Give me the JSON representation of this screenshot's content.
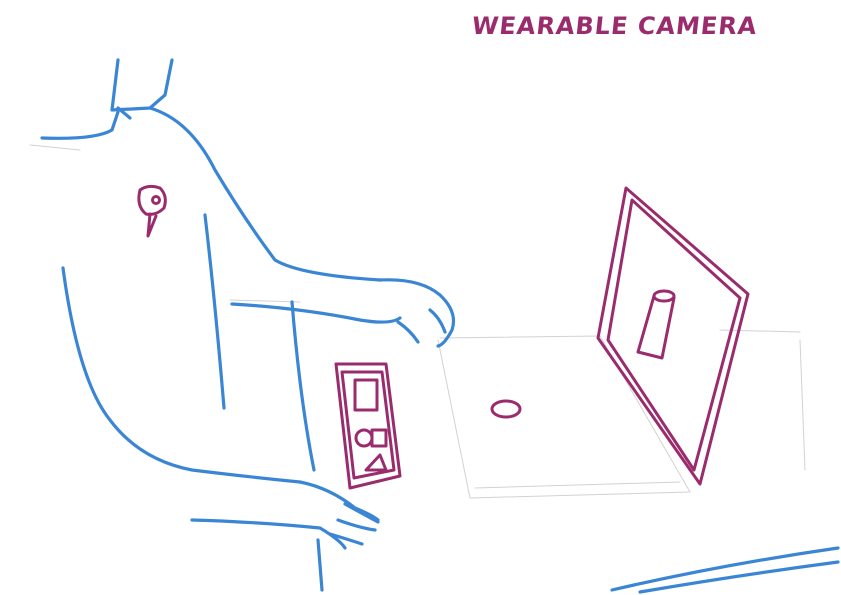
{
  "title": "WEARABLE CAMERA",
  "colors": {
    "figure_ink": "#3a86d4",
    "device_ink": "#9a2c6d",
    "faint_ink": "#d2d2d2",
    "background": "#ffffff"
  },
  "icons": {
    "wearable_camera": "wearable-camera-icon",
    "remote_control": "remote-control-icon",
    "display_screen": "display-screen-icon",
    "object": "cylinder-object-icon",
    "tabletop_object": "oval-object-icon"
  }
}
